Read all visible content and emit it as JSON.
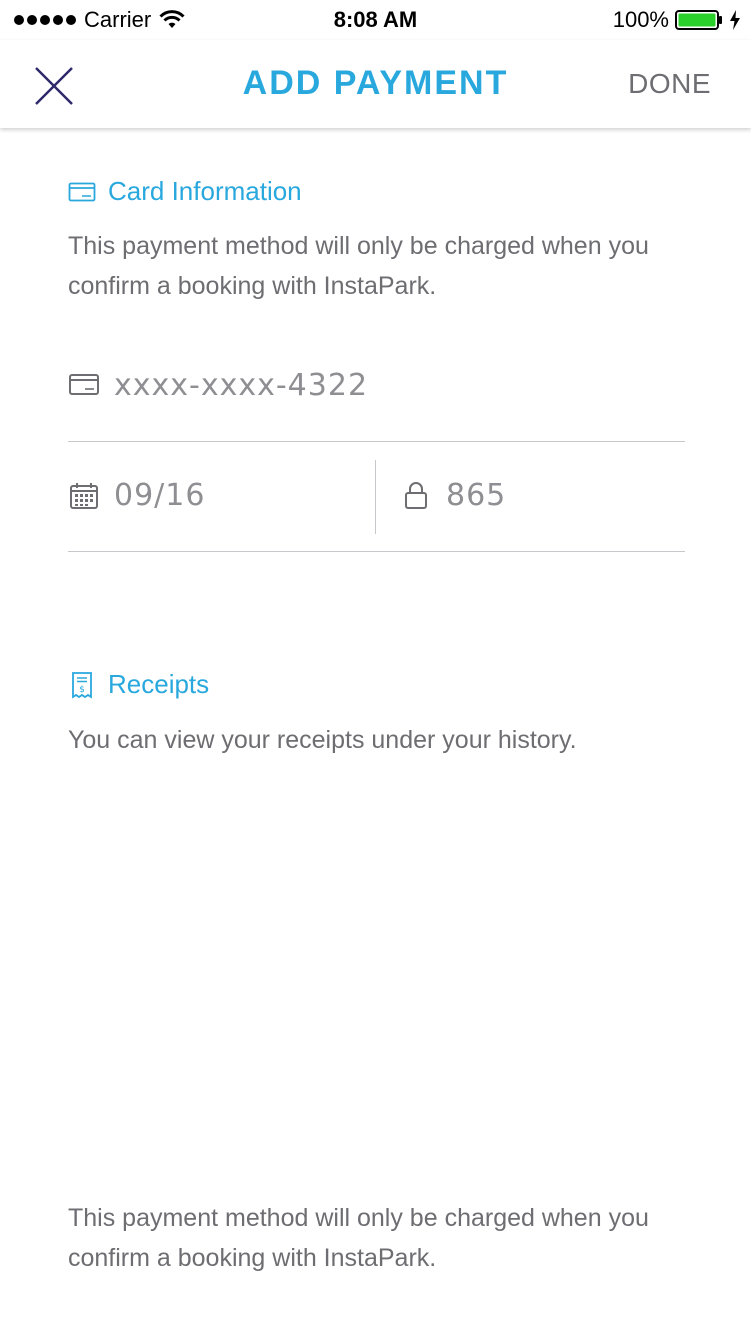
{
  "status_bar": {
    "carrier": "Carrier",
    "time": "8:08 AM",
    "battery": "100%",
    "battery_color": "#2bd12b"
  },
  "nav": {
    "close_icon": "close-x-icon",
    "title": "ADD PAYMENT",
    "done_label": "DONE",
    "accent_color": "#29a8de"
  },
  "card_info": {
    "icon": "credit-card-icon",
    "title": "Card Information",
    "description": "This payment method will only be charged when you confirm a booking with InstaPark.",
    "card_number": "xxxx-xxxx-4322",
    "expiry": "09/16",
    "cvv": "865"
  },
  "receipts": {
    "icon": "receipt-icon",
    "title": "Receipts",
    "description": "You can view your receipts under your history."
  },
  "footer": {
    "description": "This payment method will only be charged when you confirm a booking with InstaPark."
  }
}
